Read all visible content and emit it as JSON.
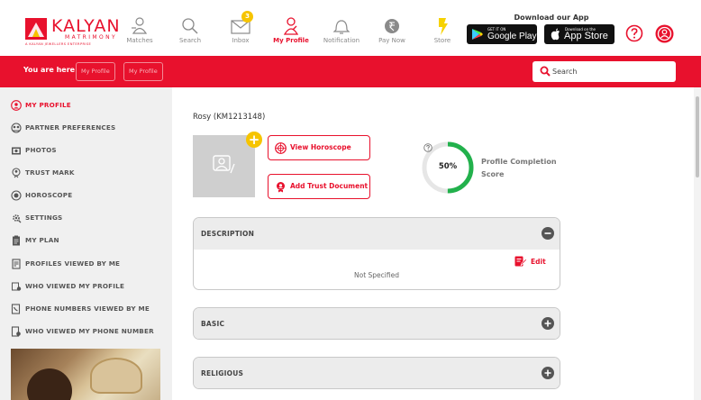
{
  "brand": {
    "name": "KALYAN",
    "sub": "MATRIMONY",
    "tagline": "A KALYAN JEWELLERS ENTERPRISE",
    "color": "#e8112d"
  },
  "nav": {
    "matches": "Matches",
    "search": "Search",
    "inbox": "Inbox",
    "inbox_count": "3",
    "profile": "My Profile",
    "notification": "Notification",
    "paynow": "Pay Now",
    "store": "Store"
  },
  "download": {
    "title": "Download our App",
    "google_small": "GET IT ON",
    "google_big": "Google Play",
    "apple_small": "Download on the",
    "apple_big": "App Store"
  },
  "breadcrumb": {
    "here": "You are here",
    "items": [
      "My Profile",
      "My Profile"
    ]
  },
  "search": {
    "placeholder": "Search"
  },
  "sidebar": {
    "items": [
      {
        "label": "MY PROFILE",
        "icon": "user-circle-icon"
      },
      {
        "label": "PARTNER PREFERENCES",
        "icon": "partner-icon"
      },
      {
        "label": "PHOTOS",
        "icon": "photos-icon"
      },
      {
        "label": "TRUST MARK",
        "icon": "trust-icon"
      },
      {
        "label": "HOROSCOPE",
        "icon": "horoscope-icon"
      },
      {
        "label": "SETTINGS",
        "icon": "settings-icon"
      },
      {
        "label": "MY PLAN",
        "icon": "plan-icon"
      },
      {
        "label": "PROFILES VIEWED BY ME",
        "icon": "profiles-viewed-icon"
      },
      {
        "label": "WHO VIEWED MY PROFILE",
        "icon": "who-viewed-icon"
      },
      {
        "label": "PHONE NUMBERS VIEWED BY ME",
        "icon": "phone-viewed-icon"
      },
      {
        "label": "WHO VIEWED MY PHONE NUMBER",
        "icon": "who-phone-icon"
      }
    ]
  },
  "profile": {
    "name": "Rosy (KM1213148)",
    "add_photo": "+",
    "view_horoscope": "View Horoscope",
    "add_trust": "Add Trust Document",
    "completion": 0.5,
    "completion_text": "50%",
    "completion_label": "Profile Completion Score",
    "completion_color": "#22b14c"
  },
  "sections": {
    "description": {
      "title": "DESCRIPTION",
      "edit": "Edit",
      "value": "Not Specified"
    },
    "basic": {
      "title": "BASIC"
    },
    "religious": {
      "title": "RELIGIOUS"
    }
  }
}
